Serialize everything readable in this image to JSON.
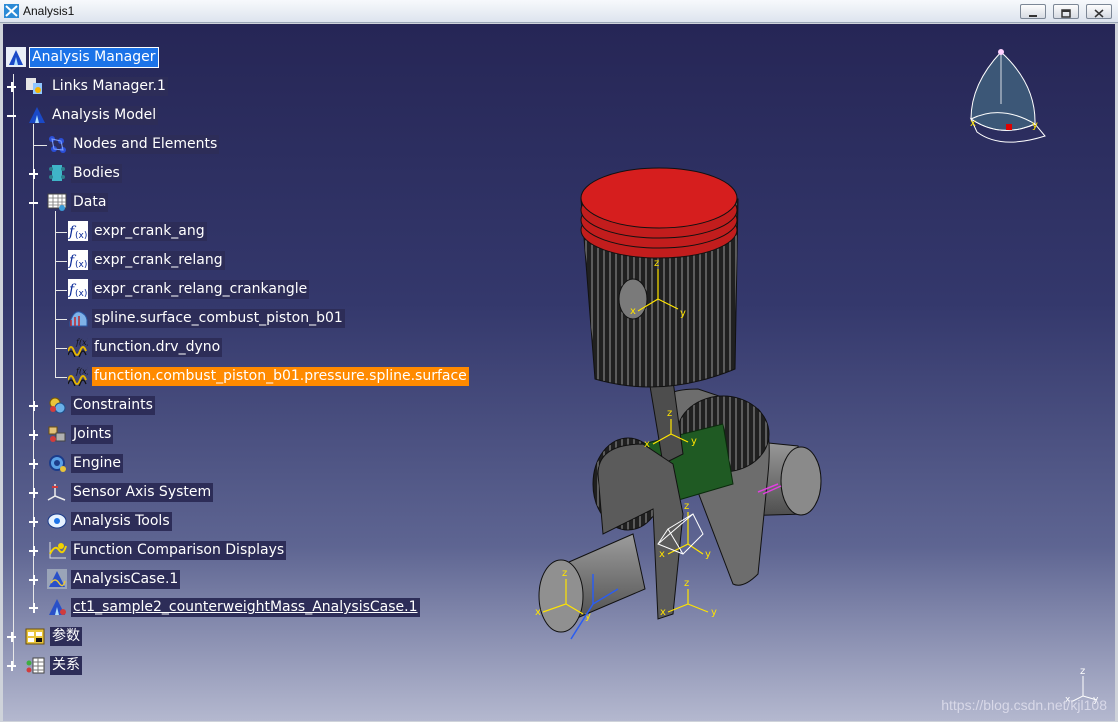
{
  "window": {
    "title": "Analysis1",
    "buttons": {
      "minimize": "minimize",
      "maximize": "maximize",
      "close": "close"
    }
  },
  "tree": {
    "nodes": [
      {
        "id": "analysis-manager",
        "label": "Analysis Manager",
        "icon": "analysis-manager-icon",
        "expander": "none",
        "state": "selected"
      },
      {
        "id": "links-manager",
        "label": "Links Manager.1",
        "icon": "links-manager-icon",
        "expander": "plus"
      },
      {
        "id": "analysis-model",
        "label": "Analysis Model",
        "icon": "analysis-model-icon",
        "expander": "minus"
      },
      {
        "id": "nodes-elements",
        "label": "Nodes and Elements",
        "icon": "nodes-elements-icon",
        "expander": "none"
      },
      {
        "id": "bodies",
        "label": "Bodies",
        "icon": "bodies-icon",
        "expander": "plus"
      },
      {
        "id": "data",
        "label": "Data",
        "icon": "data-icon",
        "expander": "minus"
      },
      {
        "id": "expr-crank-ang",
        "label": "expr_crank_ang",
        "icon": "formula-icon",
        "expander": "none"
      },
      {
        "id": "expr-crank-relang",
        "label": "expr_crank_relang",
        "icon": "formula-icon",
        "expander": "none"
      },
      {
        "id": "expr-crank-relang-crankangle",
        "label": "expr_crank_relang_crankangle",
        "icon": "formula-icon",
        "expander": "none"
      },
      {
        "id": "spline-surface",
        "label": "spline.surface_combust_piston_b01",
        "icon": "spline-icon",
        "expander": "none"
      },
      {
        "id": "function-drv-dyno",
        "label": "function.drv_dyno",
        "icon": "function-icon",
        "expander": "none"
      },
      {
        "id": "function-combust",
        "label": "function.combust_piston_b01.pressure.spline.surface",
        "icon": "function-icon",
        "expander": "none",
        "state": "highlight"
      },
      {
        "id": "constraints",
        "label": "Constraints",
        "icon": "constraints-icon",
        "expander": "plus"
      },
      {
        "id": "joints",
        "label": "Joints",
        "icon": "joints-icon",
        "expander": "plus"
      },
      {
        "id": "engine",
        "label": "Engine",
        "icon": "engine-icon",
        "expander": "plus"
      },
      {
        "id": "sensor-axis",
        "label": "Sensor Axis System",
        "icon": "sensor-axis-icon",
        "expander": "plus"
      },
      {
        "id": "analysis-tools",
        "label": "Analysis Tools",
        "icon": "analysis-tools-icon",
        "expander": "plus"
      },
      {
        "id": "function-comparison",
        "label": "Function Comparison Displays",
        "icon": "function-comparison-icon",
        "expander": "plus"
      },
      {
        "id": "analysis-case-1",
        "label": "AnalysisCase.1",
        "icon": "analysis-case-icon",
        "expander": "plus"
      },
      {
        "id": "ct1-sample2",
        "label": "ct1_sample2_counterweightMass_AnalysisCase.1",
        "icon": "analysis-case-icon",
        "expander": "plus",
        "state": "underline"
      },
      {
        "id": "parameters",
        "label": "参数",
        "icon": "parameters-icon",
        "expander": "plus"
      },
      {
        "id": "relations",
        "label": "关系",
        "icon": "relations-icon",
        "expander": "plus"
      }
    ]
  },
  "compass": {
    "axes": [
      "x",
      "y"
    ]
  },
  "axes_labels": {
    "x": "x",
    "y": "y",
    "z": "z"
  },
  "colors": {
    "piston_top": "#d61e1e",
    "rod": "#1f5a23",
    "body": "#7a7a7a",
    "selection": "#1c73e8",
    "highlight": "#ff8a00",
    "axis": "#ffe400"
  },
  "watermark": "https://blog.csdn.net/kjl108"
}
